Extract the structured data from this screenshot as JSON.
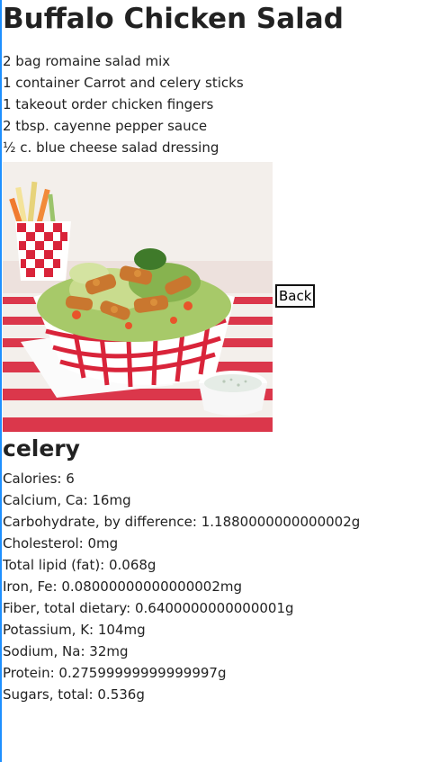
{
  "recipe": {
    "title": "Buffalo Chicken Salad",
    "ingredients": [
      "2 bag romaine salad mix",
      "1 container Carrot and celery sticks",
      "1 takeout order chicken fingers",
      "2 tbsp. cayenne pepper sauce",
      "½ c. blue cheese salad dressing"
    ],
    "back_label": "Back"
  },
  "nutrition": {
    "ingredient_name": "celery",
    "items": [
      "Calories: 6",
      "Calcium, Ca: 16mg",
      "Carbohydrate, by difference: 1.1880000000000002g",
      "Cholesterol: 0mg",
      "Total lipid (fat): 0.068g",
      "Iron, Fe: 0.08000000000000002mg",
      "Fiber, total dietary: 0.6400000000000001g",
      "Potassium, K: 104mg",
      "Sodium, Na: 32mg",
      "Protein: 0.27599999999999997g",
      "Sugars, total: 0.536g"
    ]
  },
  "colors": {
    "accent_rule": "#1e90ff",
    "stripe_red": "#d9243a"
  }
}
